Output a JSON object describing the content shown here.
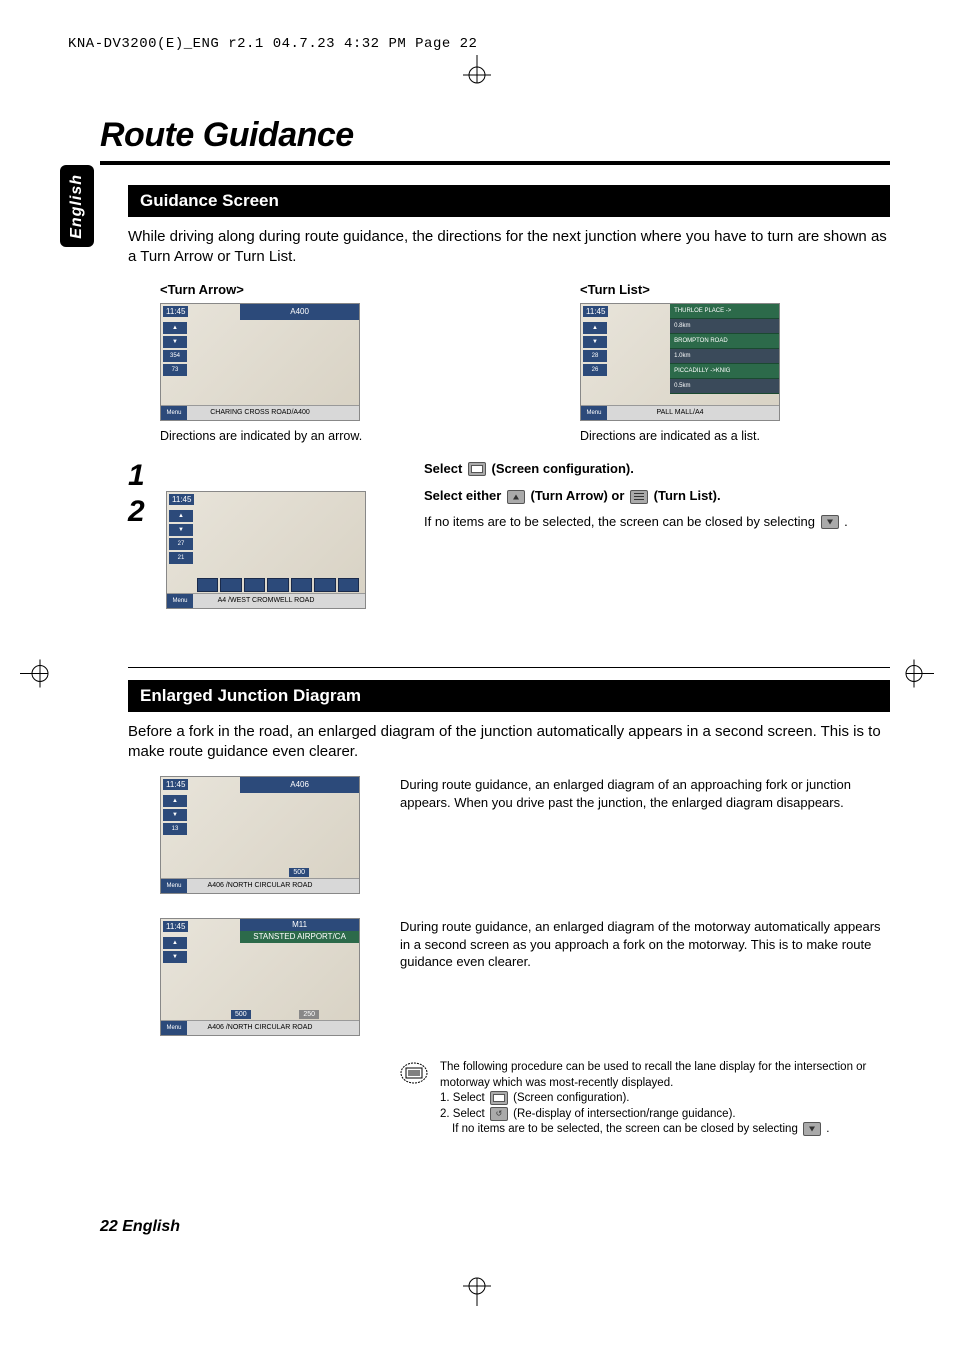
{
  "print_header": "KNA-DV3200(E)_ENG r2.1  04.7.23  4:32 PM  Page 22",
  "side_tab": "English",
  "page_title": "Route Guidance",
  "section1": {
    "heading": "Guidance Screen",
    "intro": "While driving along during route guidance, the directions for the next junction where you have to turn are shown as a Turn Arrow or Turn List.",
    "left_label": "<Turn Arrow>",
    "right_label": "<Turn List>",
    "left_caption": "Directions are indicated by an arrow.",
    "right_caption": "Directions are indicated as a list.",
    "shot_arrow": {
      "time": "11:45",
      "banner": "A400",
      "bottom": "CHARING CROSS ROAD/A400",
      "menu": "Menu",
      "side_dist": "354",
      "side_dist2": "73"
    },
    "shot_list": {
      "time": "11:45",
      "bottom": "PALL MALL/A4",
      "menu": "Menu",
      "items": [
        "THURLOE PLACE ->",
        "0.8km",
        "BROMPTON ROAD",
        "1.0km",
        "PICCADILLY ->KNIG",
        "0.5km"
      ],
      "side_dist": "28",
      "side_dist2": "26"
    }
  },
  "steps": {
    "num1": "1",
    "num2": "2",
    "step1_a": "Select ",
    "step1_b": " (Screen configuration).",
    "step2_a": "Select either ",
    "step2_b": " (Turn Arrow) or ",
    "step2_c": " (Turn List).",
    "step2_note": "If no items are to be selected, the screen can be closed by selecting ",
    "step2_note_end": " .",
    "shot": {
      "time": "11:45",
      "bottom": "A4 /WEST CROMWELL ROAD",
      "menu": "Menu",
      "side_dist": "27",
      "side_dist2": "21"
    }
  },
  "section2": {
    "heading": "Enlarged Junction Diagram",
    "intro": "Before a fork in the road, an enlarged diagram of the junction automatically appears in a second screen. This is to make route guidance even clearer.",
    "para1": "During route guidance, an enlarged diagram of an approaching fork or junction appears. When you drive past the junction, the enlarged diagram disappears.",
    "para2": "During route guidance, an enlarged diagram of the motorway automatically appears in a second screen as you approach a fork on the motorway. This is to make route guidance even clearer.",
    "shot1": {
      "time": "11:45",
      "banner": "A406",
      "bottom": "A406 /NORTH CIRCULAR ROAD",
      "menu": "Menu",
      "dist": "500",
      "side": "13"
    },
    "shot2": {
      "time": "11:45",
      "banner": "M11",
      "banner2": "STANSTED AIRPORT/CA",
      "bottom": "A406 /NORTH CIRCULAR ROAD",
      "menu": "Menu",
      "dist": "250",
      "dist2": "500"
    },
    "note_intro": "The following procedure can be used to recall the lane display for the intersection or motorway which was most-recently displayed.",
    "note_l1a": "1. Select ",
    "note_l1b": " (Screen configuration).",
    "note_l2a": "2. Select ",
    "note_l2b": " (Re-display of intersection/range guidance).",
    "note_l3": "If no items are to be selected, the screen can be closed by selecting ",
    "note_l3_end": " ."
  },
  "footer": "22 English"
}
